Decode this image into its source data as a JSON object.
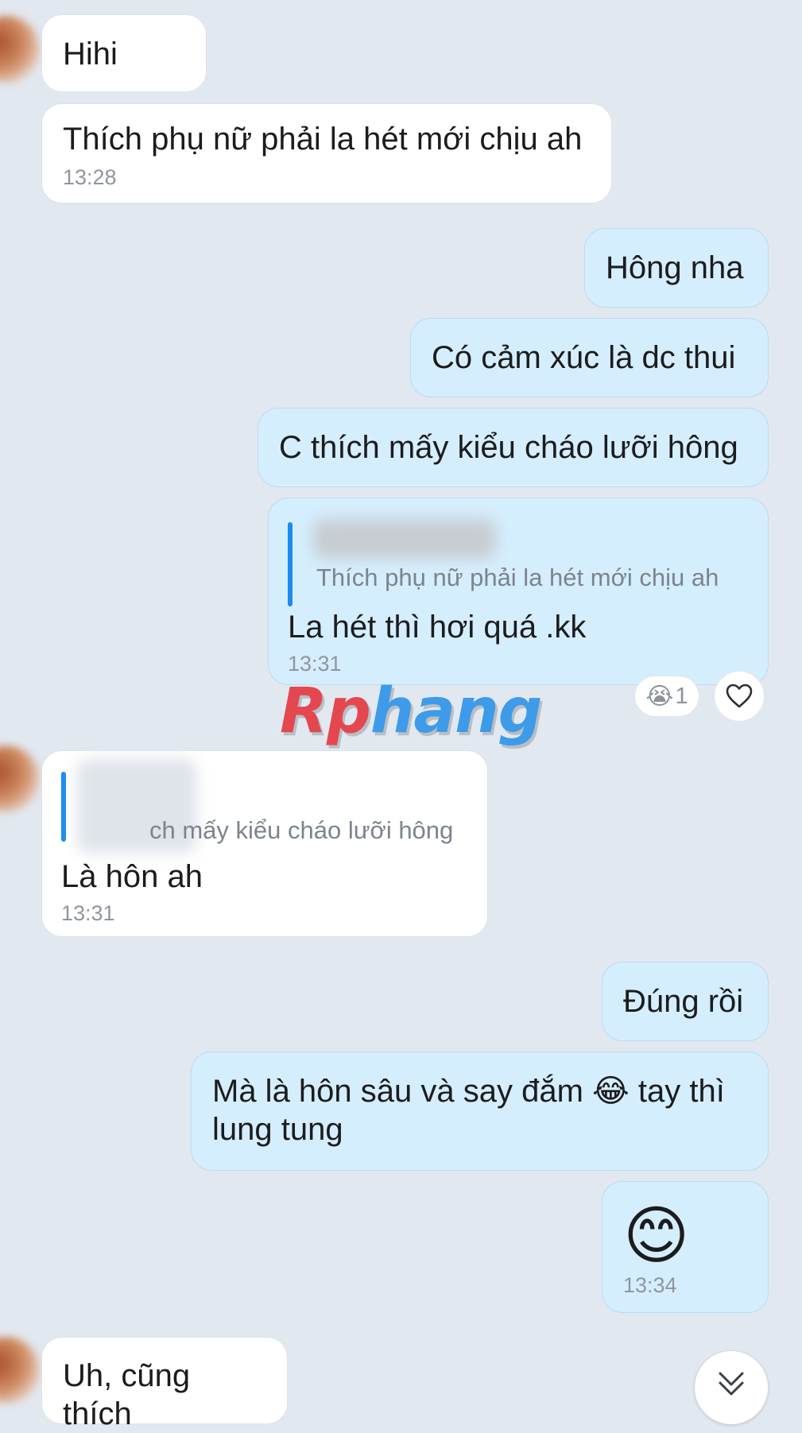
{
  "chat": {
    "m1": {
      "text": "Hihi"
    },
    "m2": {
      "text": "Thích phụ nữ phải la hét mới chịu ah",
      "time": "13:28"
    },
    "m3": {
      "text": "Hông nha"
    },
    "m4": {
      "text": "Có cảm xúc là dc thui"
    },
    "m5": {
      "text": "C thích mấy kiểu cháo lưỡi hông"
    },
    "m6": {
      "quote": "Thích phụ nữ phải la hét mới chịu ah",
      "text": "La hét thì hơi quá .kk",
      "time": "13:31",
      "reaction_emoji": "😭",
      "reaction_count": "1"
    },
    "m7": {
      "quote": "ch mấy kiểu cháo lưỡi hông",
      "text": "Là hôn ah",
      "time": "13:31"
    },
    "m8": {
      "text": "Đúng rồi"
    },
    "m9": {
      "text": "Mà là hôn sâu và say đắm 😂 tay thì lung tung"
    },
    "m10": {
      "emoji": "😊",
      "time": "13:34"
    },
    "m11": {
      "text": "Uh, cũng thích"
    }
  },
  "watermark": {
    "part1": "Rp",
    "part2": "hang"
  },
  "icons": {
    "like": "heart-outline-icon",
    "scroll": "double-chevron-down-icon"
  }
}
